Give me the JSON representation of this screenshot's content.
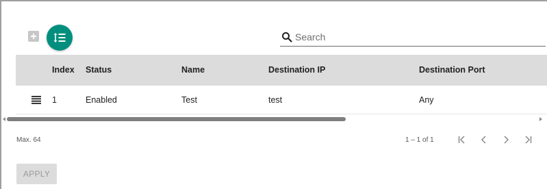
{
  "toolbar": {
    "add_icon": "plus-icon",
    "sort_icon": "reorder-icon",
    "accent": "#008f7e"
  },
  "search": {
    "placeholder": "Search",
    "value": ""
  },
  "table": {
    "columns": [
      "Index",
      "Status",
      "Name",
      "Destination IP",
      "Destination Port"
    ],
    "rows": [
      {
        "index": "1",
        "status": "Enabled",
        "name": "Test",
        "destination_ip": "test",
        "destination_port": "Any"
      }
    ]
  },
  "footer": {
    "max_label": "Max. 64",
    "range_label": "1 – 1 of 1",
    "apply_label": "APPLY"
  }
}
